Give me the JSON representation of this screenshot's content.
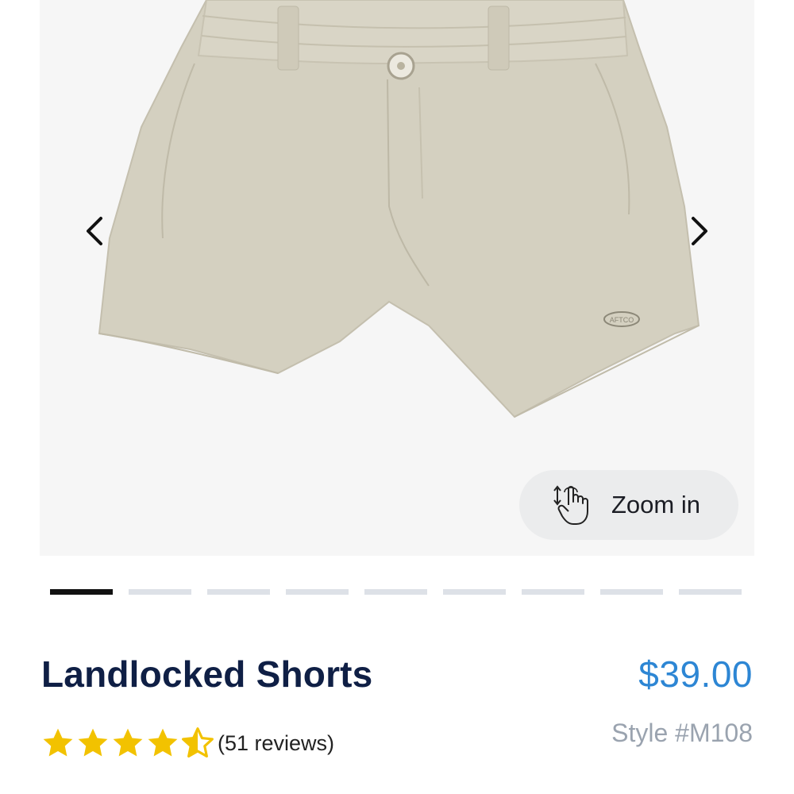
{
  "product": {
    "name": "Landlocked Shorts",
    "price": "$39.00",
    "style": "Style #M108",
    "rating": 4.5,
    "rating_max": 5,
    "reviews": "(51 reviews)",
    "logo_text": "AFTCO",
    "image_color": "#d4d0c0"
  },
  "gallery": {
    "zoom_label": "Zoom in",
    "zoom_icon": "touch-zoom-icon",
    "prev_icon": "chevron-left-icon",
    "next_icon": "chevron-right-icon",
    "active_index": 0,
    "total_images": 9
  },
  "colors": {
    "title": "#0f1f45",
    "price": "#2d86d4",
    "star": "#f2c200",
    "pager_active": "#111111",
    "pager_inactive": "#dde1e7"
  }
}
